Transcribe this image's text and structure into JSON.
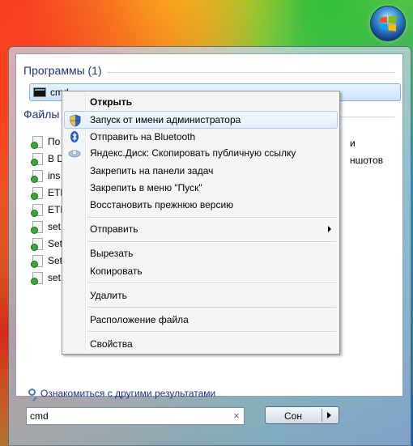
{
  "start_menu": {
    "programs_header": "Программы (1)",
    "program_item": "cmd",
    "files_header": "Файлы",
    "files": [
      "По",
      "В D",
      "ins",
      "ETD",
      "ETD",
      "set",
      "Set",
      "Set",
      "set"
    ],
    "files_right": [
      "и",
      "ншотов"
    ],
    "more_results": "Ознакомиться с другими результатами",
    "search_value": "cmd",
    "clear_glyph": "×",
    "shutdown_label": "Сон"
  },
  "context_menu": {
    "items": [
      {
        "label": "Открыть",
        "icon": ""
      },
      {
        "label": "Запуск от имени администратора",
        "icon": "uac-shield-icon"
      },
      {
        "label": "Отправить на Bluetooth",
        "icon": "bluetooth-icon"
      },
      {
        "label": "Яндекс.Диск: Скопировать публичную ссылку",
        "icon": "yandex-disk-icon"
      },
      {
        "label": "Закрепить на панели задач",
        "icon": ""
      },
      {
        "label": "Закрепить в меню \"Пуск\"",
        "icon": ""
      },
      {
        "label": "Восстановить прежнюю версию",
        "icon": ""
      },
      {
        "label": "Отправить",
        "icon": ""
      },
      {
        "label": "Вырезать",
        "icon": ""
      },
      {
        "label": "Копировать",
        "icon": ""
      },
      {
        "label": "Удалить",
        "icon": ""
      },
      {
        "label": "Расположение файла",
        "icon": ""
      },
      {
        "label": "Свойства",
        "icon": ""
      }
    ]
  },
  "colors": {
    "header_text": "#1e3287",
    "highlight_border": "#84acdd",
    "menu_bg": "#f5f5f5"
  }
}
